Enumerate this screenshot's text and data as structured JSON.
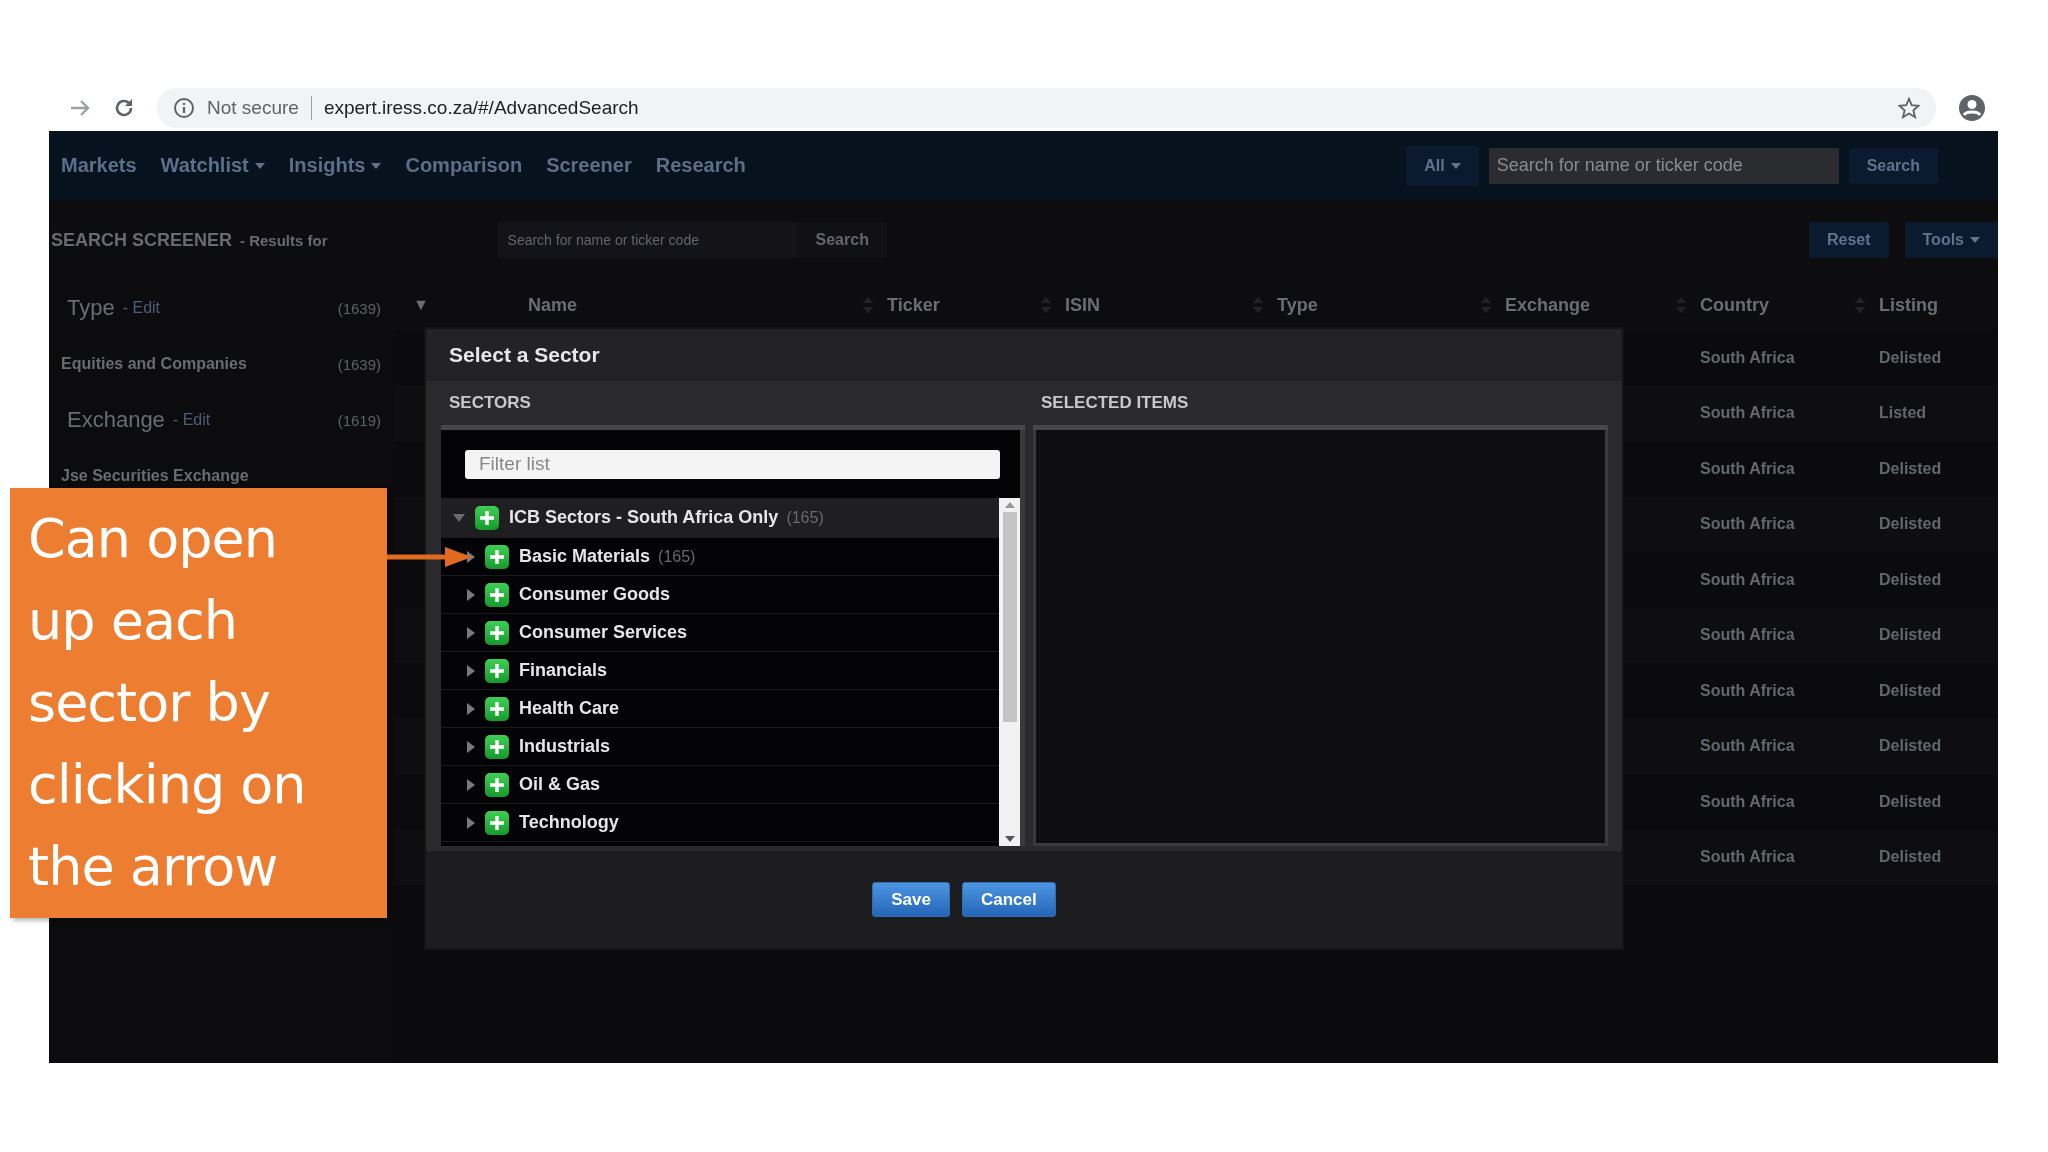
{
  "browser": {
    "security": "Not secure",
    "url": "expert.iress.co.za/#/AdvancedSearch"
  },
  "nav": {
    "items": [
      {
        "label": "Markets",
        "dropdown": false
      },
      {
        "label": "Watchlist",
        "dropdown": true
      },
      {
        "label": "Insights",
        "dropdown": true
      },
      {
        "label": "Comparison",
        "dropdown": false
      },
      {
        "label": "Screener",
        "dropdown": false
      },
      {
        "label": "Research",
        "dropdown": false
      }
    ],
    "scope": "All",
    "search_placeholder": "Search for name or ticker code",
    "search_button": "Search"
  },
  "toolbar": {
    "title": "SEARCH SCREENER",
    "subtitle": "- Results for",
    "search_placeholder": "Search for name or ticker code",
    "search_button": "Search",
    "buttons": [
      {
        "label": "Reset",
        "dropdown": false
      },
      {
        "label": "Tools",
        "dropdown": true
      }
    ]
  },
  "sidebar": {
    "groups": [
      {
        "title": "Type",
        "edit": "- Edit",
        "count": "(1639)",
        "items": [
          {
            "label": "Equities and Companies",
            "count": "(1639)"
          }
        ]
      },
      {
        "title": "Exchange",
        "edit": "- Edit",
        "count": "(1619)",
        "items": [
          {
            "label": "Jse Securities Exchange"
          }
        ]
      }
    ]
  },
  "table": {
    "toggle": "▼",
    "columns": [
      "Name",
      "Ticker",
      "ISIN",
      "Type",
      "Exchange",
      "Country",
      "Listing"
    ],
    "rows": [
      {
        "country": "South Africa",
        "listing": "Delisted"
      },
      {
        "country": "South Africa",
        "listing": "Listed"
      },
      {
        "country": "South Africa",
        "listing": "Delisted"
      },
      {
        "country": "South Africa",
        "listing": "Delisted"
      },
      {
        "country": "South Africa",
        "listing": "Delisted"
      },
      {
        "country": "South Africa",
        "listing": "Delisted"
      },
      {
        "country": "South Africa",
        "listing": "Delisted"
      },
      {
        "country": "South Africa",
        "listing": "Delisted"
      },
      {
        "country": "South Africa",
        "listing": "Delisted"
      },
      {
        "country": "South Africa",
        "listing": "Delisted"
      }
    ]
  },
  "dialog": {
    "title": "Select a Sector",
    "sectors_label": "SECTORS",
    "selected_label": "SELECTED ITEMS",
    "filter_placeholder": "Filter list",
    "tree": {
      "label": "ICB Sectors - South Africa Only",
      "count": "(165)",
      "expanded": true,
      "selected": true,
      "children": [
        {
          "label": "Basic Materials",
          "count": "(165)",
          "expanded": false,
          "selected": false
        },
        {
          "label": "Consumer Goods",
          "expanded": false,
          "selected": false
        },
        {
          "label": "Consumer Services",
          "expanded": false,
          "selected": false
        },
        {
          "label": "Financials",
          "expanded": false,
          "selected": false
        },
        {
          "label": "Health Care",
          "expanded": false,
          "selected": false
        },
        {
          "label": "Industrials",
          "expanded": false,
          "selected": false
        },
        {
          "label": "Oil & Gas",
          "expanded": false,
          "selected": false
        },
        {
          "label": "Technology",
          "expanded": false,
          "selected": false
        }
      ]
    },
    "buttons": [
      "Save",
      "Cancel"
    ]
  },
  "callout": {
    "lines": [
      "Can open",
      "up each",
      "sector by",
      "clicking on",
      "the arrow"
    ]
  }
}
